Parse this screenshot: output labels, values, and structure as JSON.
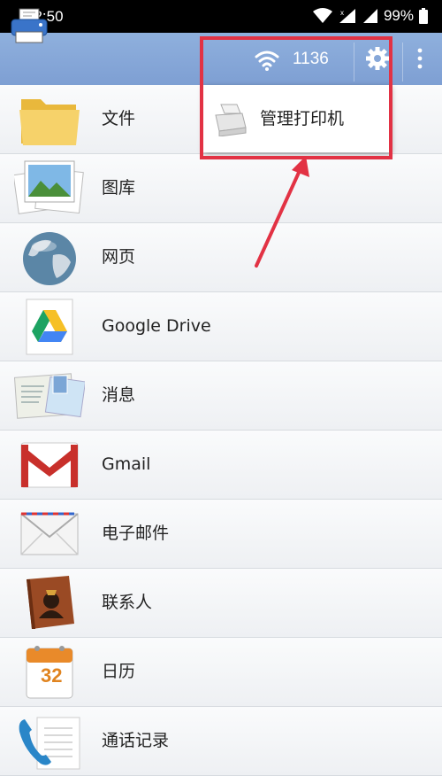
{
  "status": {
    "time": "12:50",
    "battery": "99%"
  },
  "toolbar": {
    "count": "1136"
  },
  "menu": {
    "item_label": "管理打印机"
  },
  "list": [
    {
      "label": "文件"
    },
    {
      "label": "图库"
    },
    {
      "label": "网页"
    },
    {
      "label": "Google Drive"
    },
    {
      "label": "消息"
    },
    {
      "label": "Gmail"
    },
    {
      "label": "电子邮件"
    },
    {
      "label": "联系人"
    },
    {
      "label": "日历"
    },
    {
      "label": "通话记录"
    }
  ],
  "calendar_icon_number": "32",
  "colors": {
    "appbar": "#8fb0dd",
    "highlight": "#e23244",
    "accent": "#ffffff"
  }
}
